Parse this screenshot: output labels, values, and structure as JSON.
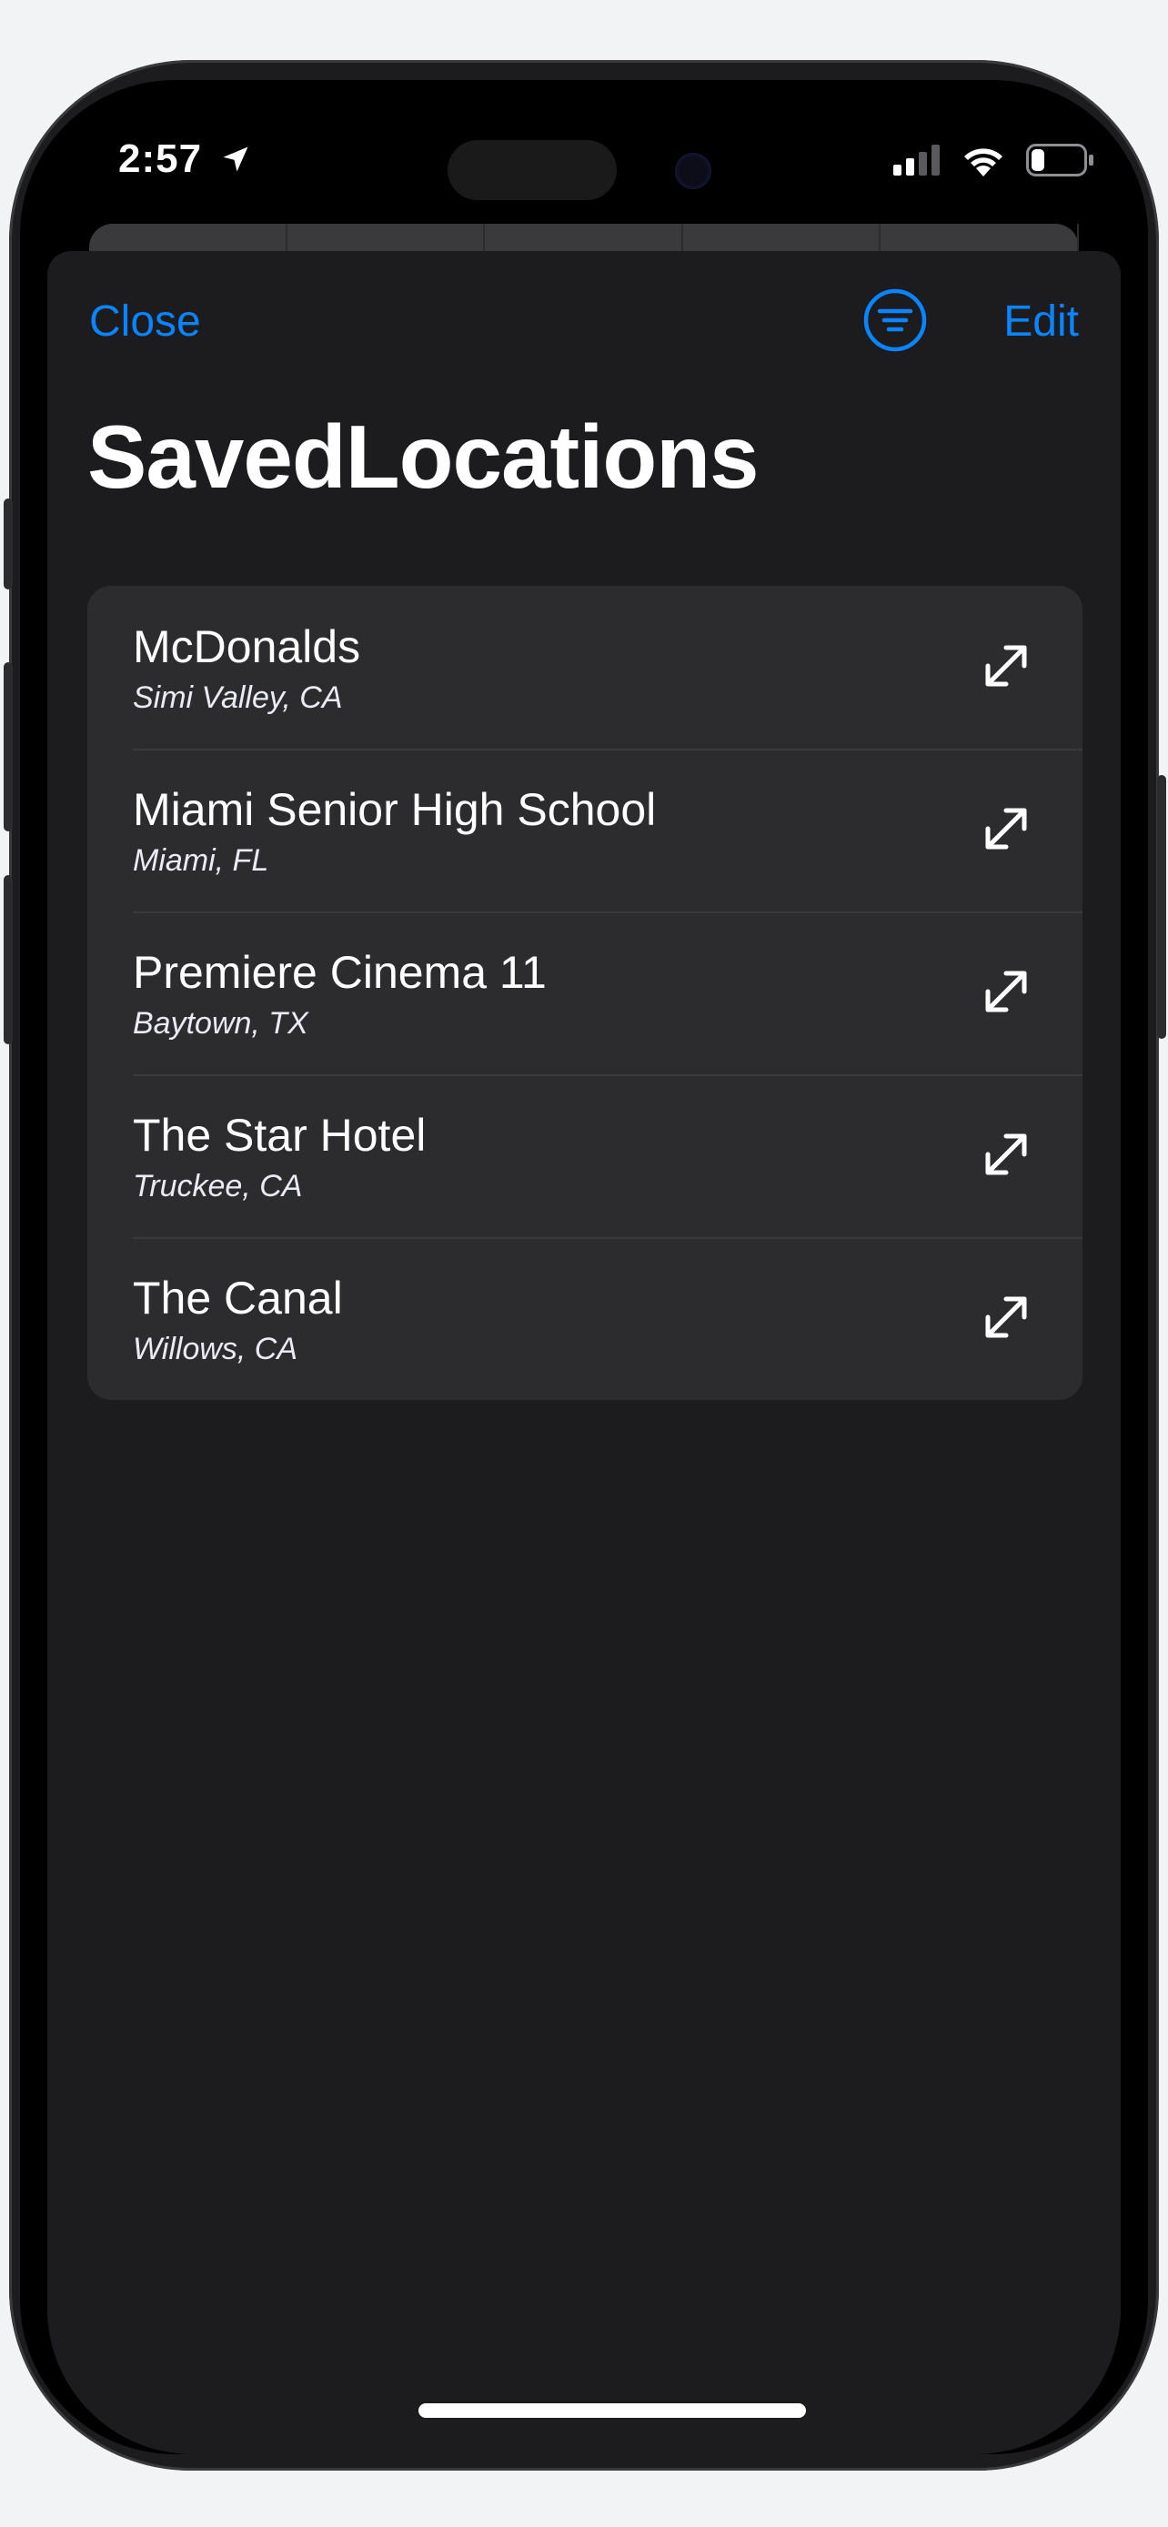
{
  "status_bar": {
    "time": "2:57",
    "location_icon": "location-arrow-icon",
    "signal_icon": "cellular-signal-icon",
    "wifi_icon": "wifi-icon",
    "battery_icon": "battery-icon",
    "battery_level": 0.25
  },
  "nav": {
    "close_label": "Close",
    "filter_icon": "filter-icon",
    "edit_label": "Edit"
  },
  "page": {
    "title": "SavedLocations"
  },
  "locations": [
    {
      "name": "McDonalds",
      "place": "Simi Valley, CA",
      "action_icon": "expand-icon"
    },
    {
      "name": "Miami Senior High School",
      "place": "Miami, FL",
      "action_icon": "expand-icon"
    },
    {
      "name": "Premiere Cinema 11",
      "place": "Baytown, TX",
      "action_icon": "expand-icon"
    },
    {
      "name": "The Star Hotel",
      "place": "Truckee, CA",
      "action_icon": "expand-icon"
    },
    {
      "name": "The Canal",
      "place": "Willows, CA",
      "action_icon": "expand-icon"
    }
  ],
  "colors": {
    "accent": "#0a84ff",
    "background": "#1c1c1e",
    "card": "#2c2c2e",
    "separator": "#3a3a3c"
  }
}
